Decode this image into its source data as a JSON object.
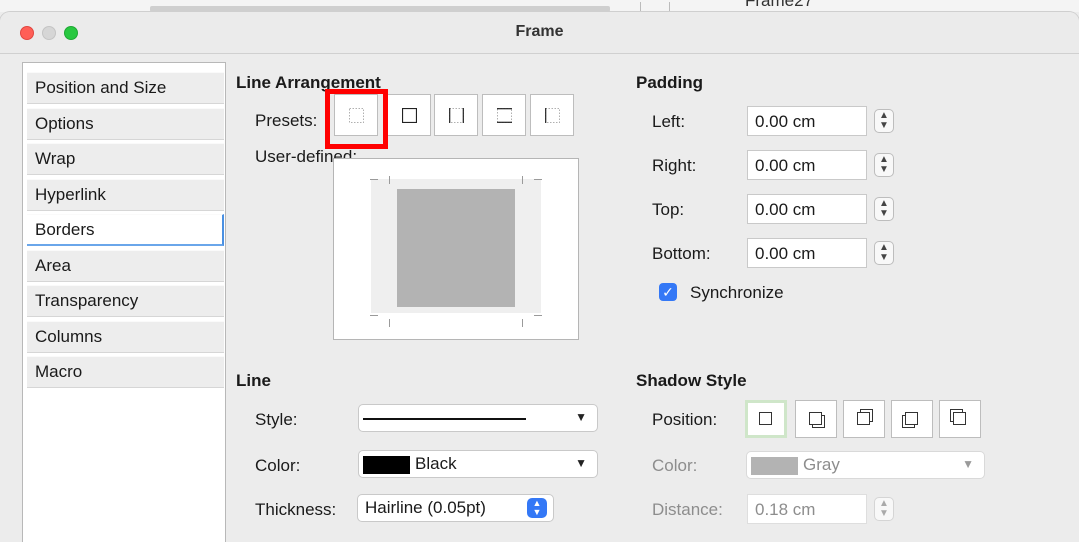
{
  "background": {
    "title_fragment": "Frame27"
  },
  "window": {
    "title": "Frame"
  },
  "sidebar": {
    "items": [
      {
        "label": "Position and Size"
      },
      {
        "label": "Options"
      },
      {
        "label": "Wrap"
      },
      {
        "label": "Hyperlink"
      },
      {
        "label": "Borders",
        "active": true
      },
      {
        "label": "Area"
      },
      {
        "label": "Transparency"
      },
      {
        "label": "Columns"
      },
      {
        "label": "Macro"
      }
    ]
  },
  "line_arrangement": {
    "title": "Line Arrangement",
    "presets_label": "Presets:",
    "user_defined_label": "User-defined:",
    "presets": [
      "none-icon",
      "box-icon",
      "left-right-icon",
      "top-bottom-icon",
      "left-only-icon"
    ]
  },
  "padding": {
    "title": "Padding",
    "left_label": "Left:",
    "left_value": "0.00 cm",
    "right_label": "Right:",
    "right_value": "0.00 cm",
    "top_label": "Top:",
    "top_value": "0.00 cm",
    "bottom_label": "Bottom:",
    "bottom_value": "0.00 cm",
    "synchronize_label": "Synchronize",
    "synchronize_checked": true
  },
  "line": {
    "title": "Line",
    "style_label": "Style:",
    "color_label": "Color:",
    "color_value": "Black",
    "color_hex": "#000000",
    "thickness_label": "Thickness:",
    "thickness_value": "Hairline (0.05pt)"
  },
  "shadow": {
    "title": "Shadow Style",
    "position_label": "Position:",
    "color_label": "Color:",
    "color_value": "Gray",
    "color_hex": "#b3b3b3",
    "distance_label": "Distance:",
    "distance_value": "0.18 cm"
  }
}
